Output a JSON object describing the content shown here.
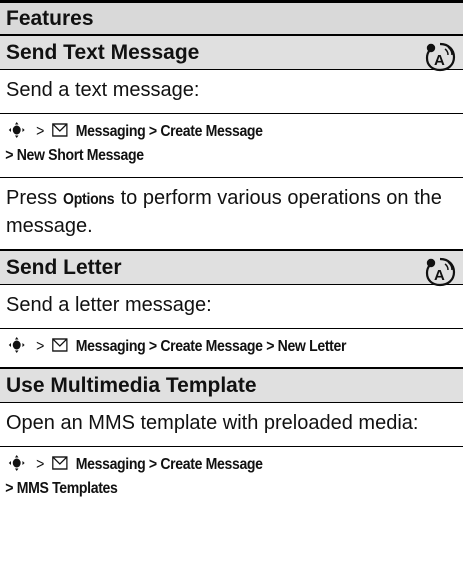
{
  "header": {
    "title": "Features"
  },
  "sections": [
    {
      "title": "Send Text Message",
      "intro": "Send a text message:",
      "path_line1": "Messaging > Create Message",
      "path_line2": "> New Short Message",
      "note_prefix": "Press ",
      "note_keyword": "Options",
      "note_suffix": " to perform various operations on the message.",
      "icon": "network-feature-icon"
    },
    {
      "title": "Send Letter",
      "intro": "Send a letter message:",
      "path_line1": "Messaging > Create Message > New Letter",
      "icon": "network-feature-icon"
    },
    {
      "title": "Use Multimedia Template",
      "intro": "Open an MMS template with preloaded media:",
      "path_line1": "Messaging > Create Message",
      "path_line2": "> MMS Templates"
    }
  ],
  "icons": {
    "nav_key": "nav-key-icon",
    "message": "envelope-icon"
  },
  "separator": ">"
}
